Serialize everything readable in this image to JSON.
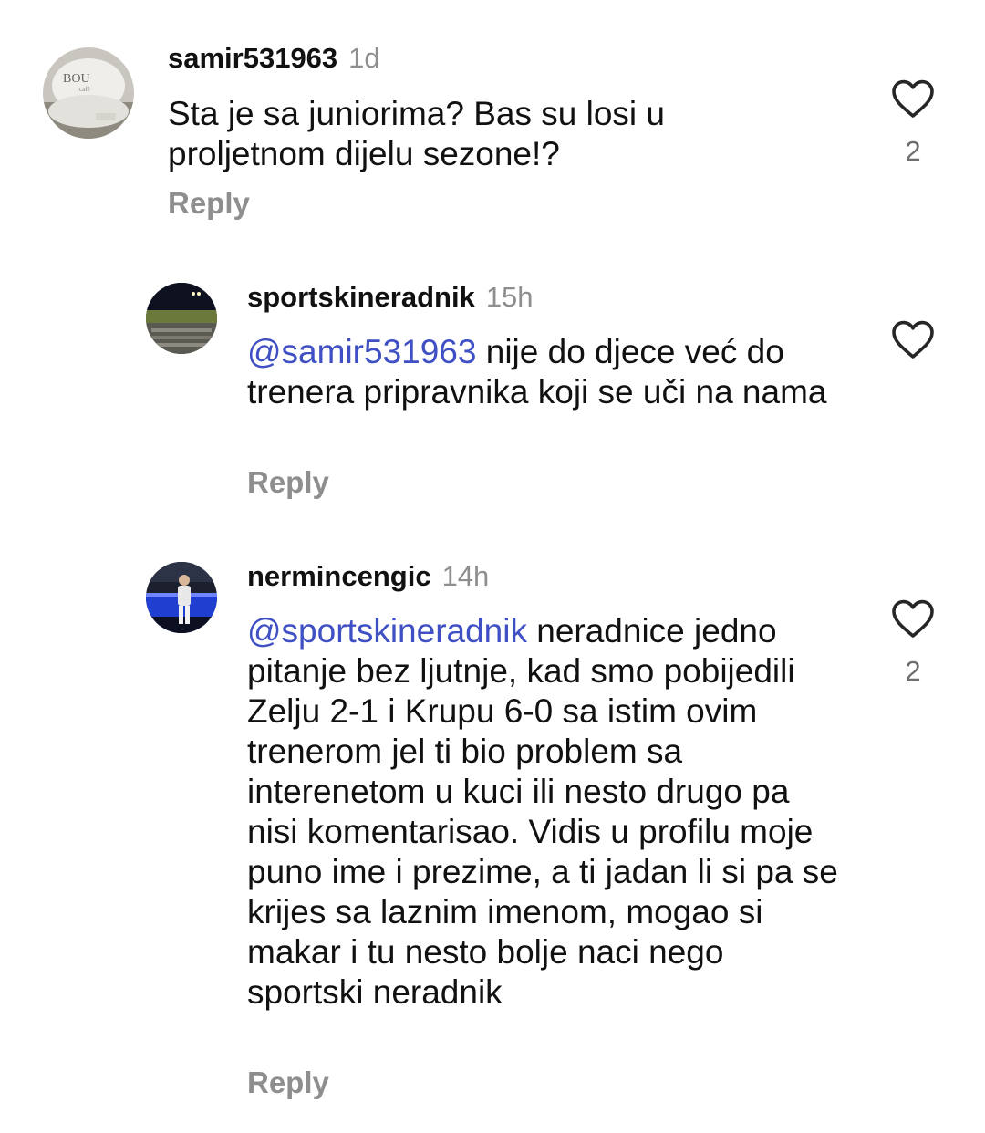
{
  "comments": [
    {
      "username": "samir531963",
      "time": "1d",
      "mention": "",
      "text": "Sta je sa juniorima? Bas su losi u proljetnom dijelu sezone!?",
      "reply_label": "Reply",
      "like_count": "2",
      "avatar_icon": "cafe-cup-photo"
    },
    {
      "username": "sportskineradnik",
      "time": "15h",
      "mention": "@samir531963",
      "text": " nije do djece već do trenera pripravnika koji se uči na nama",
      "reply_label": "Reply",
      "like_count": "",
      "avatar_icon": "stadium-night-photo"
    },
    {
      "username": "nermincengic",
      "time": "14h",
      "mention": "@sportskineradnik",
      "text": " neradnice jedno pitanje bez ljutnje, kad smo pobijedili Zelju 2-1 i Krupu 6-0 sa istim ovim trenerom jel ti bio problem sa interenetom u kuci ili nesto drugo pa nisi komentarisao. Vidis u profilu moje puno ime i prezime, a ti jadan li si pa se krijes sa laznim imenom, mogao si makar i tu nesto bolje naci nego sportski neradnik",
      "reply_label": "Reply",
      "like_count": "2",
      "avatar_icon": "person-stadium-photo"
    }
  ],
  "colors": {
    "mention": "#3f4fc4",
    "secondary_text": "#8e8e8e",
    "like_count": "#6e6e6e"
  }
}
